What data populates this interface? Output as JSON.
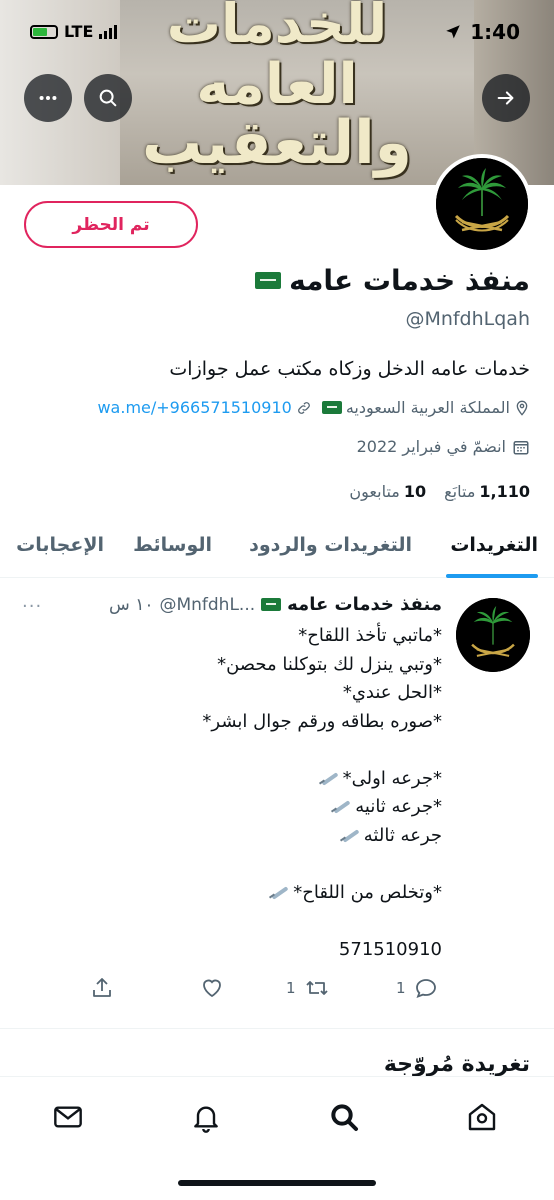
{
  "status_bar": {
    "network": "LTE",
    "time": "1:40"
  },
  "banner": {
    "lines": [
      "للخدمات",
      "العامه",
      "والتعقيب"
    ]
  },
  "profile": {
    "blocked_label": "تم الحظر",
    "name": "منفذ خدمات عامه",
    "handle": "@MnfdhLqah",
    "bio": "خدمات عامه الدخل وزكاه مكتب عمل جوازات",
    "location": "المملكة العربية السعوديه",
    "link": "wa.me/+966571510910",
    "joined": "انضمّ في فبراير 2022",
    "following_count": "10",
    "following_label": "متابعون",
    "followers_count": "1,110",
    "followers_label": "متابَع"
  },
  "tabs": [
    {
      "label": "التغريدات",
      "active": true
    },
    {
      "label": "التغريدات والردود",
      "active": false
    },
    {
      "label": "الوسائط",
      "active": false
    },
    {
      "label": "الإعجابات",
      "active": false
    }
  ],
  "tweet": {
    "author_name": "منفذ خدمات عامه",
    "author_handle": "@MnfdhL...",
    "time": "١٠ س",
    "more": "···",
    "lines": [
      "*ماتبي تأخذ اللقاح*",
      "*وتبي ينزل لك بتوكلنا محصن*",
      "*الحل عندي*",
      "*صوره بطاقه ورقم جوال ابشر*",
      "",
      "*جرعه اولى*",
      "*جرعه ثانيه",
      "جرعه ثالثه",
      "",
      "*وتخلص من اللقاح*",
      "",
      "571510910"
    ],
    "reply_count": "1",
    "retweet_count": "1"
  },
  "promoted_heading": "تغريدة مُروّجة",
  "icons": {
    "banner": [
      "arrow-right-icon",
      "search-icon",
      "more-icon"
    ],
    "nav": [
      "mail-icon",
      "bell-icon",
      "search-icon",
      "home-icon"
    ]
  }
}
